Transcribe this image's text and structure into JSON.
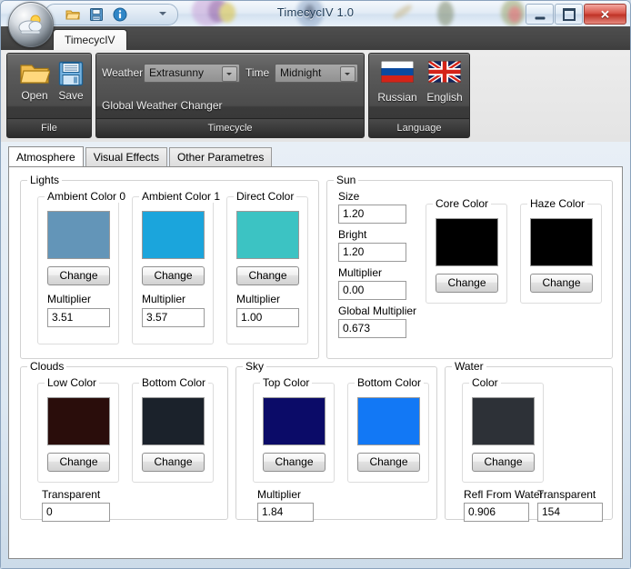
{
  "window": {
    "title": "TimecycIV 1.0",
    "orb_icon": "weather-cloud-sun-icon",
    "quick_access": [
      {
        "name": "open-icon",
        "label": "Open"
      },
      {
        "name": "save-icon",
        "label": "Save"
      },
      {
        "name": "info-icon",
        "label": "About"
      }
    ],
    "buttons": {
      "minimize": "minimize-button",
      "maximize": "maximize-button",
      "close": "✕"
    }
  },
  "ribbon": {
    "tab": "TimecycIV",
    "groups": [
      {
        "id": "file",
        "footer": "File",
        "buttons": [
          {
            "label": "Open",
            "icon": "folder-open-icon"
          },
          {
            "label": "Save",
            "icon": "floppy-disk-icon"
          }
        ]
      },
      {
        "id": "timecycle",
        "footer": "Timecycle",
        "weather_label": "Weather",
        "weather_value": "Extrasunny",
        "time_label": "Time",
        "time_value": "Midnight",
        "global_label": "Global Weather Changer"
      },
      {
        "id": "language",
        "footer": "Language",
        "buttons": [
          {
            "label": "Russian",
            "icon": "russian-flag-icon"
          },
          {
            "label": "English",
            "icon": "uk-flag-icon"
          }
        ]
      }
    ]
  },
  "tabs": [
    {
      "label": "Atmosphere",
      "active": true
    },
    {
      "label": "Visual Effects",
      "active": false
    },
    {
      "label": "Other Parametres",
      "active": false
    }
  ],
  "atmosphere": {
    "lights": {
      "caption": "Lights",
      "items": [
        {
          "caption": "Ambient Color 0",
          "color": "#6395b8",
          "button": "Change",
          "mult_label": "Multiplier",
          "mult_value": "3.51"
        },
        {
          "caption": "Ambient Color 1",
          "color": "#1ba5dc",
          "button": "Change",
          "mult_label": "Multiplier",
          "mult_value": "3.57"
        },
        {
          "caption": "Direct Color",
          "color": "#3cc3c3",
          "button": "Change",
          "mult_label": "Multiplier",
          "mult_value": "1.00"
        }
      ]
    },
    "sun": {
      "caption": "Sun",
      "fields": [
        {
          "label": "Size",
          "value": "1.20"
        },
        {
          "label": "Bright",
          "value": "1.20"
        },
        {
          "label": "Multiplier",
          "value": "0.00"
        },
        {
          "label": "Global Multiplier",
          "value": "0.673"
        }
      ],
      "colors": [
        {
          "caption": "Core Color",
          "color": "#000000",
          "button": "Change"
        },
        {
          "caption": "Haze Color",
          "color": "#000000",
          "button": "Change"
        }
      ]
    },
    "clouds": {
      "caption": "Clouds",
      "colors": [
        {
          "caption": "Low Color",
          "color": "#2a0d0b",
          "button": "Change"
        },
        {
          "caption": "Bottom Color",
          "color": "#1b222b",
          "button": "Change"
        }
      ],
      "transparent_label": "Transparent",
      "transparent_value": "0"
    },
    "sky": {
      "caption": "Sky",
      "colors": [
        {
          "caption": "Top Color",
          "color": "#0b0b68",
          "button": "Change"
        },
        {
          "caption": "Bottom Color",
          "color": "#1278f5",
          "button": "Change"
        }
      ],
      "mult_label": "Multiplier",
      "mult_value": "1.84"
    },
    "water": {
      "caption": "Water",
      "colors": [
        {
          "caption": "Color",
          "color": "#2d3137",
          "button": "Change"
        }
      ],
      "refl_label": "Refl From Water",
      "refl_value": "0.906",
      "transparent_label": "Transparent",
      "transparent_value": "154"
    }
  }
}
